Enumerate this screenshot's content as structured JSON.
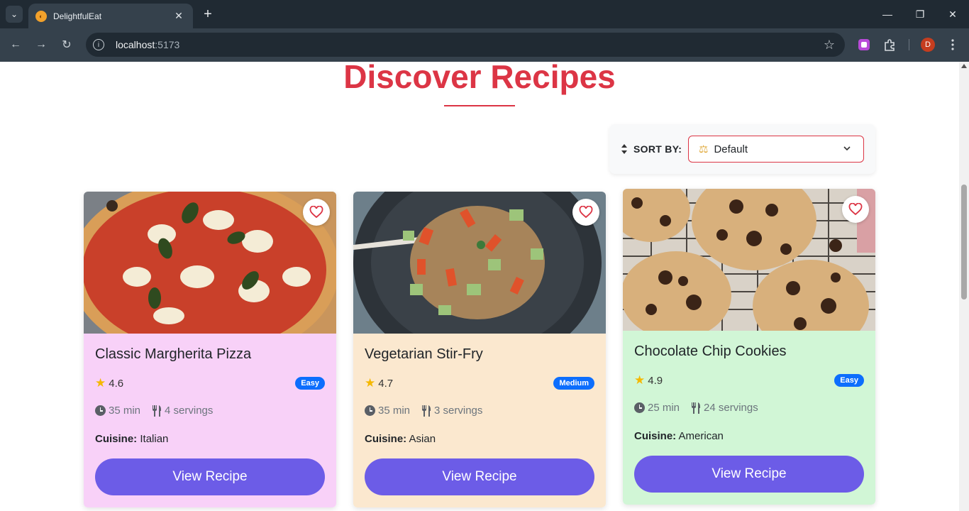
{
  "browser": {
    "tab_title": "DelightfulEat",
    "url_host": "localhost",
    "url_port": ":5173",
    "profile_initial": "D"
  },
  "page": {
    "heading": "Discover Recipes",
    "sort_label": "SORT BY:",
    "sort_value": "Default"
  },
  "recipes": [
    {
      "title": "Classic Margherita Pizza",
      "rating": "4.6",
      "difficulty": "Easy",
      "time": "35 min",
      "servings": "4 servings",
      "cuisine_label": "Cuisine:",
      "cuisine": "Italian",
      "button": "View Recipe",
      "bg": "#f8d1f8"
    },
    {
      "title": "Vegetarian Stir-Fry",
      "rating": "4.7",
      "difficulty": "Medium",
      "time": "35 min",
      "servings": "3 servings",
      "cuisine_label": "Cuisine:",
      "cuisine": "Asian",
      "button": "View Recipe",
      "bg": "#fbe8cf"
    },
    {
      "title": "Chocolate Chip Cookies",
      "rating": "4.9",
      "difficulty": "Easy",
      "time": "25 min",
      "servings": "24 servings",
      "cuisine_label": "Cuisine:",
      "cuisine": "American",
      "button": "View Recipe",
      "bg": "#d1f6d6"
    }
  ],
  "colors": {
    "accent": "#dc3545",
    "button": "#6c5ce7",
    "badge": "#0d6efd"
  }
}
